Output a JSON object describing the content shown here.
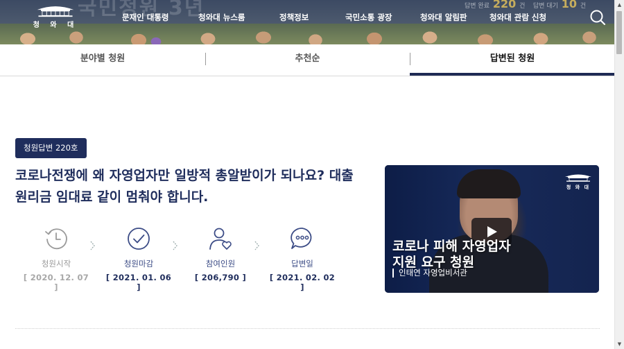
{
  "header": {
    "logo_text": "청 와 대",
    "nav": [
      "문재인 대통령",
      "청와대 뉴스룸",
      "정책정보",
      "국민소통 광장",
      "청와대 알림판",
      "청와대 관람 신청"
    ],
    "banner_title": "국민청원 3년",
    "stats": {
      "answered_label": "답변 완료",
      "answered_value": "220",
      "answered_unit": "건",
      "waiting_label": "답변 대기",
      "waiting_value": "10",
      "waiting_unit": "건"
    },
    "search_icon": "search-icon"
  },
  "tabs": [
    {
      "label": "분야별 청원",
      "active": false
    },
    {
      "label": "추천순",
      "active": false
    },
    {
      "label": "답변된 청원",
      "active": true
    }
  ],
  "petition": {
    "badge": "청원답변 220호",
    "title": "코로나전쟁에 왜 자영업자만 일방적 총알받이가 되나요? 대출원리금 임대료 같이 멈춰야 합니다.",
    "steps": [
      {
        "icon": "clock-icon",
        "label": "청원시작",
        "value": "[ 2020. 12. 07 ]",
        "state": "done"
      },
      {
        "icon": "check-circle-icon",
        "label": "청원마감",
        "value": "[ 2021. 01. 06 ]",
        "state": "current"
      },
      {
        "icon": "person-heart-icon",
        "label": "참여인원",
        "value": "[ 206,790 ]",
        "state": "current"
      },
      {
        "icon": "speech-bubble-icon",
        "label": "답변일",
        "value": "[ 2021. 02. 02 ]",
        "state": "current"
      }
    ]
  },
  "video": {
    "caption_line1": "코로나 피해 자영업자",
    "caption_line2": "지원 요구 청원",
    "subtitle": "인태연 자영업비서관",
    "logo_text": "청 와 대",
    "play_icon": "play-icon"
  },
  "colors": {
    "navy": "#1f2d5c",
    "tab_underline": "#1e2a54",
    "gray_step": "#9a9a9a"
  }
}
